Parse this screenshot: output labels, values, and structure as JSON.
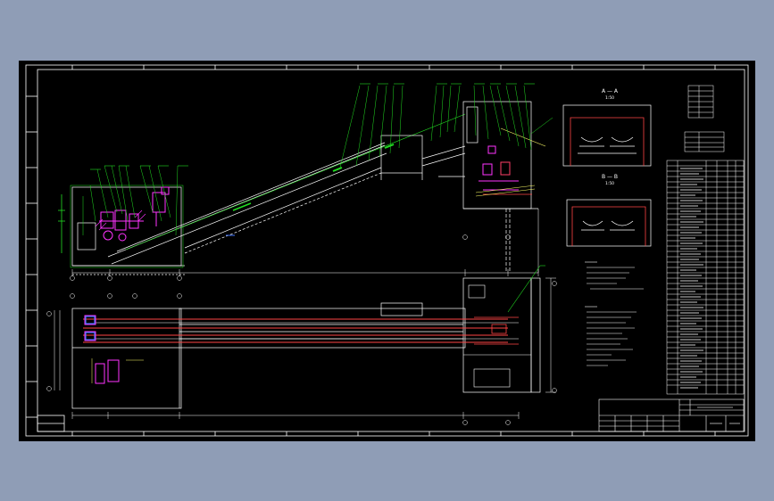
{
  "background_color": "#8f9db6",
  "canvas_color": "#000000",
  "line_colors": {
    "frame": "#ffffff",
    "conveyor": "#ffffff",
    "callouts": "#22dd22",
    "equipment": "#ff33ff",
    "sections": "#ff4444",
    "annotations": "#ffff66",
    "blue_marks": "#4477ff"
  },
  "drawing": {
    "section_a_label": "A — A",
    "section_a_scale": "1:50",
    "section_b_label": "B — B",
    "section_b_scale": "1:50"
  }
}
